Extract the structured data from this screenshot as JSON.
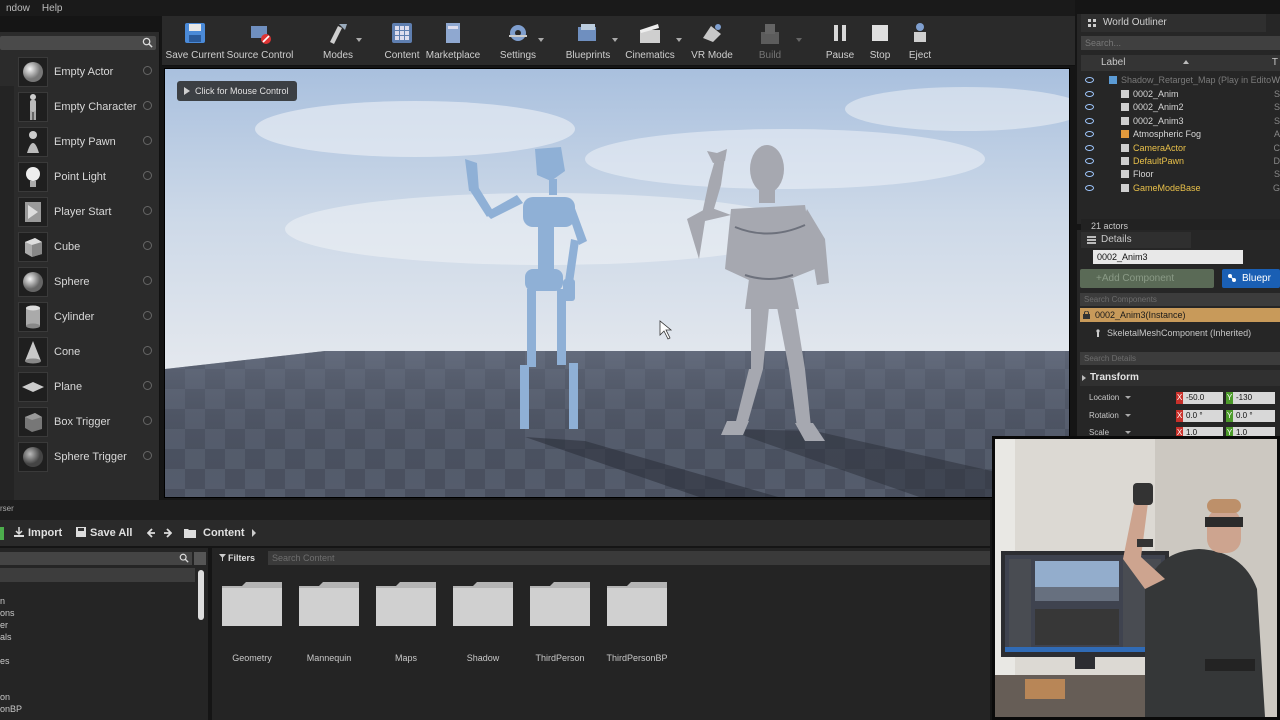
{
  "menu": {
    "items": [
      "ndow",
      "Help"
    ]
  },
  "place_actors": {
    "items": [
      {
        "label": "Empty Actor",
        "icon": "empty-actor-icon"
      },
      {
        "label": "Empty Character",
        "icon": "character-icon"
      },
      {
        "label": "Empty Pawn",
        "icon": "pawn-icon"
      },
      {
        "label": "Point Light",
        "icon": "point-light-icon"
      },
      {
        "label": "Player Start",
        "icon": "player-start-icon"
      },
      {
        "label": "Cube",
        "icon": "cube-icon"
      },
      {
        "label": "Sphere",
        "icon": "sphere-icon"
      },
      {
        "label": "Cylinder",
        "icon": "cylinder-icon"
      },
      {
        "label": "Cone",
        "icon": "cone-icon"
      },
      {
        "label": "Plane",
        "icon": "plane-icon"
      },
      {
        "label": "Box Trigger",
        "icon": "box-trigger-icon"
      },
      {
        "label": "Sphere Trigger",
        "icon": "sphere-trigger-icon"
      }
    ]
  },
  "toolbar": {
    "buttons": [
      {
        "label": "Save Current",
        "icon": "save-icon"
      },
      {
        "label": "Source Control",
        "icon": "source-control-icon"
      },
      {
        "label": "Modes",
        "icon": "modes-icon"
      },
      {
        "label": "Content",
        "icon": "content-icon"
      },
      {
        "label": "Marketplace",
        "icon": "marketplace-icon"
      },
      {
        "label": "Settings",
        "icon": "settings-icon"
      },
      {
        "label": "Blueprints",
        "icon": "blueprints-icon"
      },
      {
        "label": "Cinematics",
        "icon": "cinematics-icon"
      },
      {
        "label": "VR Mode",
        "icon": "vr-icon"
      },
      {
        "label": "Build",
        "icon": "build-icon"
      },
      {
        "label": "Pause",
        "icon": "pause-icon"
      },
      {
        "label": "Stop",
        "icon": "stop-icon"
      },
      {
        "label": "Eject",
        "icon": "eject-icon"
      }
    ]
  },
  "viewport": {
    "hint": "Click for Mouse Control"
  },
  "outliner": {
    "title": "World Outliner",
    "search_placeholder": "Search...",
    "col_label": "Label",
    "col_type": "T",
    "rows": [
      {
        "name": "Shadow_Retarget_Map (Play in Edito",
        "type": "W",
        "color": "#7a7a7a"
      },
      {
        "name": "0002_Anim",
        "type": "S",
        "color": "#d6d6d6"
      },
      {
        "name": "0002_Anim2",
        "type": "S",
        "color": "#d6d6d6"
      },
      {
        "name": "0002_Anim3",
        "type": "S",
        "color": "#d6d6d6"
      },
      {
        "name": "Atmospheric Fog",
        "type": "A",
        "color": "#d6d6d6"
      },
      {
        "name": "CameraActor",
        "type": "C",
        "color": "#e8c04a"
      },
      {
        "name": "DefaultPawn",
        "type": "D",
        "color": "#e8c04a"
      },
      {
        "name": "Floor",
        "type": "S",
        "color": "#d6d6d6"
      },
      {
        "name": "GameModeBase",
        "type": "G",
        "color": "#e8c04a"
      }
    ],
    "actors_count": "21 actors"
  },
  "details": {
    "title": "Details",
    "actor_name": "0002_Anim3",
    "add_component": "+Add Component",
    "blueprint": "Bluepr",
    "search_components": "Search Components",
    "instance": "0002_Anim3(Instance)",
    "skeletal": "SkeletalMeshComponent (Inherited)",
    "search_details": "Search Details",
    "transform": "Transform",
    "location_label": "Location",
    "rotation_label": "Rotation",
    "scale_label": "Scale",
    "x_axis": "X",
    "y_axis": "Y",
    "loc_x": "-50.0",
    "loc_y": "-130",
    "rot_x": "0.0 °",
    "rot_y": "0.0 °",
    "scale_x": "1.0",
    "scale_y": "1.0"
  },
  "content_browser": {
    "tab": "rser",
    "import": "Import",
    "save_all": "Save All",
    "path": "Content",
    "filters": "Filters",
    "search_placeholder": "Search Content",
    "tree": [
      "n",
      "ons",
      "er",
      "als",
      "es",
      "on",
      "onBP"
    ],
    "folders": [
      "Geometry",
      "Mannequin",
      "Maps",
      "Shadow",
      "ThirdPerson",
      "ThirdPersonBP"
    ]
  },
  "colors": {
    "accent_blue": "#1a5fb4",
    "instance_highlight": "#c89a5a",
    "add_component_green": "#5a6a56"
  }
}
